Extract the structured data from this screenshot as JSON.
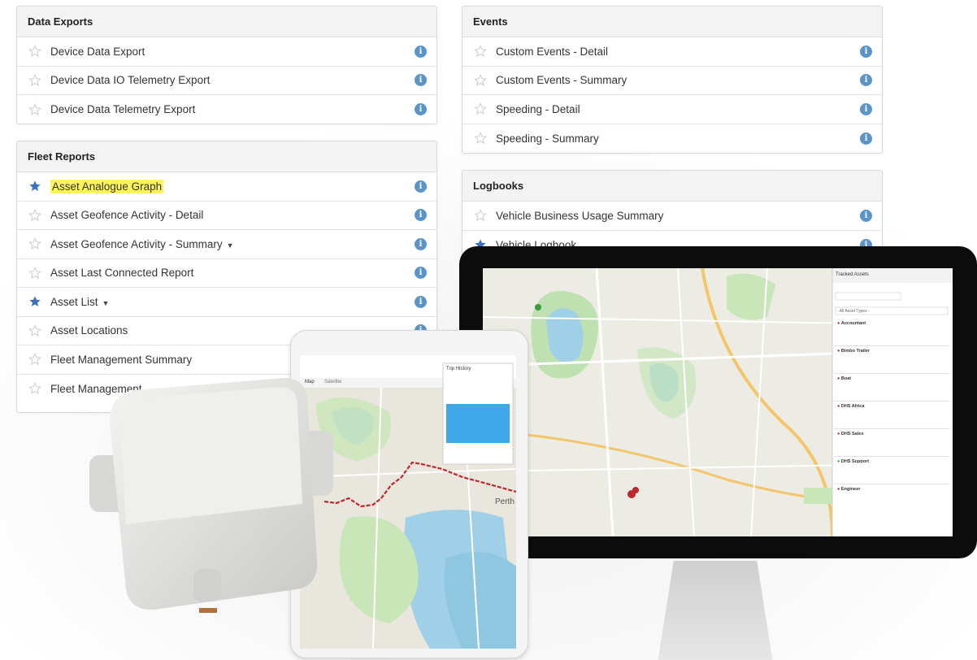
{
  "data_exports": {
    "title": "Data Exports",
    "items": [
      {
        "label": "Device Data Export",
        "starred": false
      },
      {
        "label": "Device Data IO Telemetry Export",
        "starred": false
      },
      {
        "label": "Device Data Telemetry Export",
        "starred": false
      }
    ]
  },
  "fleet_reports": {
    "title": "Fleet Reports",
    "items": [
      {
        "label": "Asset Analogue Graph",
        "starred": true,
        "highlighted": true
      },
      {
        "label": "Asset Geofence Activity - Detail",
        "starred": false
      },
      {
        "label": "Asset Geofence Activity - Summary",
        "starred": false,
        "dropdown": true
      },
      {
        "label": "Asset Last Connected Report",
        "starred": false
      },
      {
        "label": "Asset List",
        "starred": true,
        "dropdown": true
      },
      {
        "label": "Asset Locations",
        "starred": false
      },
      {
        "label": "Fleet Management Summary",
        "starred": false
      },
      {
        "label": "Fleet Management",
        "starred": false
      }
    ]
  },
  "events": {
    "title": "Events",
    "items": [
      {
        "label": "Custom Events - Detail",
        "starred": false
      },
      {
        "label": "Custom Events - Summary",
        "starred": false
      },
      {
        "label": "Speeding - Detail",
        "starred": false
      },
      {
        "label": "Speeding - Summary",
        "starred": false
      }
    ]
  },
  "logbooks": {
    "title": "Logbooks",
    "items": [
      {
        "label": "Vehicle Business Usage Summary",
        "starred": false
      },
      {
        "label": "Vehicle Logbook",
        "starred": true
      }
    ]
  },
  "monitor_panel": {
    "title": "Tracked Assets",
    "filter": "- All Asset Types -",
    "assets": [
      "Accountant",
      "Bimbo Trailer",
      "Boat",
      "DHS Africa",
      "DHS Sales",
      "DHS Support",
      "Engineer"
    ]
  },
  "tablet_panel": {
    "tabs": [
      "Map",
      "Satellite"
    ],
    "title": "Trip History"
  },
  "map_labels": {
    "city": "Perth"
  },
  "colors": {
    "info_icon": "#5b94c8",
    "star_active": "#3a72c0",
    "star_inactive": "#cfcfcf",
    "highlight": "#fff45c",
    "route": "#c0262e"
  }
}
